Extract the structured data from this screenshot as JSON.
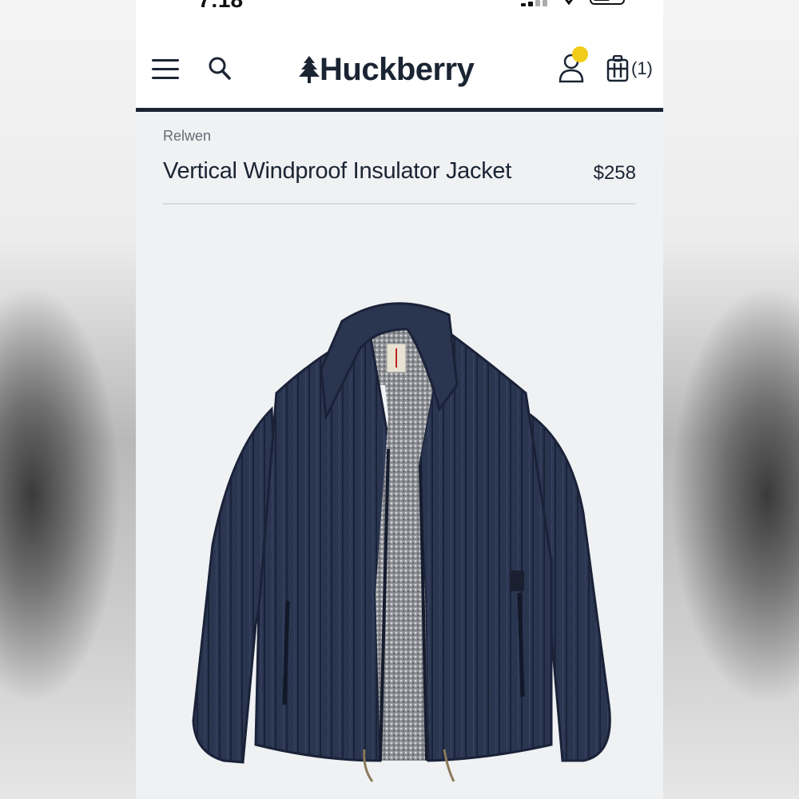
{
  "status_bar": {
    "time": "7:18"
  },
  "header": {
    "logo_text": "Huckberry",
    "cart_count": "(1)"
  },
  "product": {
    "brand": "Relwen",
    "title": "Vertical Windproof Insulator Jacket",
    "price": "$258"
  },
  "colors": {
    "brand_navy": "#1b2433",
    "notification_dot": "#f2cc1a",
    "page_background": "#f0f1f3"
  },
  "icons": [
    "menu-icon",
    "search-icon",
    "tree-icon",
    "account-icon",
    "cart-icon",
    "signal-icon",
    "wifi-icon",
    "battery-icon"
  ]
}
